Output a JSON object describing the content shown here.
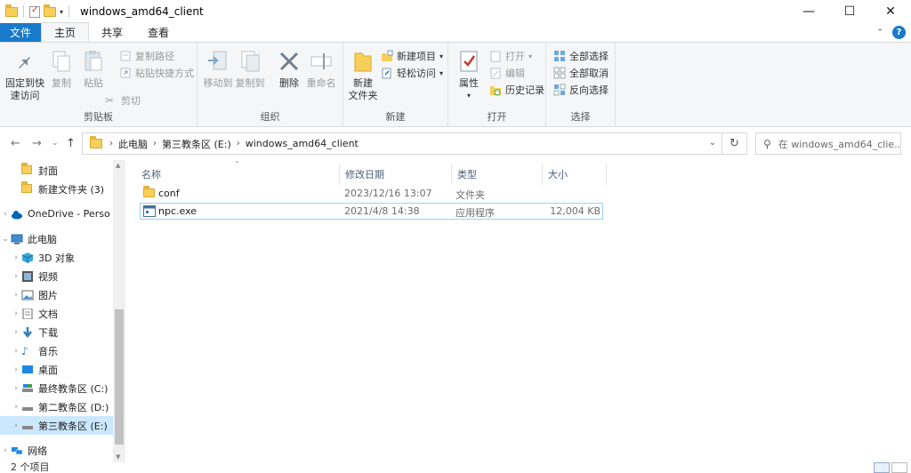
{
  "window": {
    "title": "windows_amd64_client",
    "controls": [
      "—",
      "☐",
      "✕"
    ]
  },
  "tabs": [
    {
      "label": "文件"
    },
    {
      "label": "主页"
    },
    {
      "label": "共享"
    },
    {
      "label": "查看"
    }
  ],
  "ribbon": {
    "clipboard": {
      "label": "剪贴板",
      "pin": "固定到快\n速访问",
      "copy": "复制",
      "paste": "粘贴",
      "copy_path": "复制路径",
      "paste_shortcut": "粘贴快捷方式",
      "cut": "剪切"
    },
    "organize": {
      "label": "组织",
      "move_to": "移动到",
      "copy_to": "复制到",
      "delete": "删除",
      "rename": "重命名"
    },
    "new": {
      "label": "新建",
      "new_folder": "新建\n文件夹",
      "new_item": "新建项目",
      "easy_access": "轻松访问"
    },
    "open": {
      "label": "打开",
      "properties": "属性",
      "open": "打开",
      "edit": "编辑",
      "history": "历史记录"
    },
    "select": {
      "label": "选择",
      "select_all": "全部选择",
      "select_none": "全部取消",
      "invert": "反向选择"
    }
  },
  "address": {
    "crumbs": [
      "此电脑",
      "第三教条区 (E:)",
      "windows_amd64_client"
    ],
    "search_placeholder": "在 windows_amd64_clie..."
  },
  "nav": {
    "items": [
      {
        "label": "封面",
        "icon": "folder-icon"
      },
      {
        "label": "新建文件夹 (3)",
        "icon": "folder-icon"
      },
      {
        "label": "OneDrive - Perso",
        "icon": "cloud-icon"
      },
      {
        "label": "此电脑",
        "icon": "computer-icon"
      },
      {
        "label": "3D 对象",
        "icon": "cube-icon"
      },
      {
        "label": "视频",
        "icon": "video-icon"
      },
      {
        "label": "图片",
        "icon": "picture-icon"
      },
      {
        "label": "文档",
        "icon": "document-icon"
      },
      {
        "label": "下载",
        "icon": "download-icon"
      },
      {
        "label": "音乐",
        "icon": "music-icon"
      },
      {
        "label": "桌面",
        "icon": "desktop-icon"
      },
      {
        "label": "最终教条区 (C:)",
        "icon": "drive-icon"
      },
      {
        "label": "第二教条区 (D:)",
        "icon": "drive-icon"
      },
      {
        "label": "第三教条区 (E:)",
        "icon": "drive-icon"
      },
      {
        "label": "网络",
        "icon": "network-icon"
      }
    ]
  },
  "list": {
    "columns": [
      "名称",
      "修改日期",
      "类型",
      "大小"
    ],
    "rows": [
      {
        "name": "conf",
        "date": "2023/12/16 13:07",
        "type": "文件夹",
        "size": ""
      },
      {
        "name": "npc.exe",
        "date": "2021/4/8 14:38",
        "type": "应用程序",
        "size": "12,004 KB"
      }
    ]
  },
  "status": {
    "count": "2 个项目"
  },
  "colors": {
    "accent": "#1979ca",
    "selection": "#cce8ff",
    "folder": "#f7cf5a"
  }
}
